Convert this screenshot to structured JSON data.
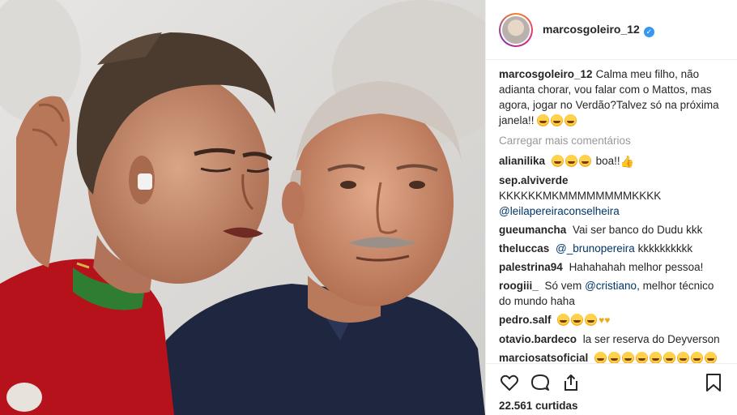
{
  "post": {
    "username": "marcosgoleiro_12",
    "verified": true,
    "caption": "Calma meu filho, não adianta chorar, vou falar com o Mattos, mas agora, jogar no Verdão?Talvez só na próxima janela!!",
    "caption_emoji_count": 3
  },
  "load_more_label": "Carregar mais comentários",
  "comments": [
    {
      "user": "alianilika",
      "emojis_before": 3,
      "text": "boa!!",
      "trailing": "thumbs-up"
    },
    {
      "user": "sep.alviverde",
      "text": "KKKKKKMKMMMMMMMMKKKK",
      "mention": "@leilapereiraconselheira"
    },
    {
      "user": "gueumancha",
      "text": "Vai ser banco do Dudu kkk"
    },
    {
      "user": "theluccas",
      "mention": "@_brunopereira",
      "text": "kkkkkkkkkk"
    },
    {
      "user": "palestrina94",
      "text": "Hahahahah melhor pessoa!"
    },
    {
      "user": "roogiii_",
      "text": "Só vem",
      "mention": "@cristiano",
      "text_after": ", melhor técnico do mundo haha"
    },
    {
      "user": "pedro.salf",
      "emojis_before": 3,
      "trailing": "hearts"
    },
    {
      "user": "otavio.bardeco",
      "text": "la ser reserva do Deyverson"
    },
    {
      "user": "marciosatsoficial",
      "emojis_before": 9
    }
  ],
  "likes_label": "22.561 curtidas",
  "colors": {
    "link": "#003569",
    "muted": "#999999",
    "verified": "#3897f0",
    "jersey_red": "#b5121b"
  },
  "icons": [
    "heart-icon",
    "comment-icon",
    "share-icon",
    "bookmark-icon"
  ]
}
